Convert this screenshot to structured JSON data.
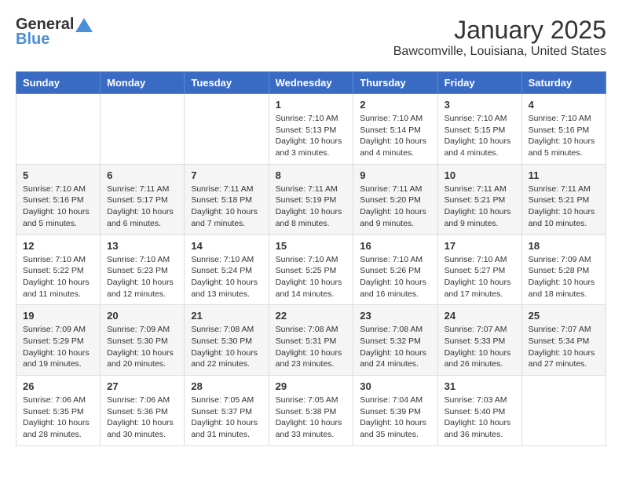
{
  "header": {
    "logo_general": "General",
    "logo_blue": "Blue",
    "month": "January 2025",
    "location": "Bawcomville, Louisiana, United States"
  },
  "weekdays": [
    "Sunday",
    "Monday",
    "Tuesday",
    "Wednesday",
    "Thursday",
    "Friday",
    "Saturday"
  ],
  "weeks": [
    [
      {
        "day": "",
        "info": ""
      },
      {
        "day": "",
        "info": ""
      },
      {
        "day": "",
        "info": ""
      },
      {
        "day": "1",
        "info": "Sunrise: 7:10 AM\nSunset: 5:13 PM\nDaylight: 10 hours\nand 3 minutes."
      },
      {
        "day": "2",
        "info": "Sunrise: 7:10 AM\nSunset: 5:14 PM\nDaylight: 10 hours\nand 4 minutes."
      },
      {
        "day": "3",
        "info": "Sunrise: 7:10 AM\nSunset: 5:15 PM\nDaylight: 10 hours\nand 4 minutes."
      },
      {
        "day": "4",
        "info": "Sunrise: 7:10 AM\nSunset: 5:16 PM\nDaylight: 10 hours\nand 5 minutes."
      }
    ],
    [
      {
        "day": "5",
        "info": "Sunrise: 7:10 AM\nSunset: 5:16 PM\nDaylight: 10 hours\nand 5 minutes."
      },
      {
        "day": "6",
        "info": "Sunrise: 7:11 AM\nSunset: 5:17 PM\nDaylight: 10 hours\nand 6 minutes."
      },
      {
        "day": "7",
        "info": "Sunrise: 7:11 AM\nSunset: 5:18 PM\nDaylight: 10 hours\nand 7 minutes."
      },
      {
        "day": "8",
        "info": "Sunrise: 7:11 AM\nSunset: 5:19 PM\nDaylight: 10 hours\nand 8 minutes."
      },
      {
        "day": "9",
        "info": "Sunrise: 7:11 AM\nSunset: 5:20 PM\nDaylight: 10 hours\nand 9 minutes."
      },
      {
        "day": "10",
        "info": "Sunrise: 7:11 AM\nSunset: 5:21 PM\nDaylight: 10 hours\nand 9 minutes."
      },
      {
        "day": "11",
        "info": "Sunrise: 7:11 AM\nSunset: 5:21 PM\nDaylight: 10 hours\nand 10 minutes."
      }
    ],
    [
      {
        "day": "12",
        "info": "Sunrise: 7:10 AM\nSunset: 5:22 PM\nDaylight: 10 hours\nand 11 minutes."
      },
      {
        "day": "13",
        "info": "Sunrise: 7:10 AM\nSunset: 5:23 PM\nDaylight: 10 hours\nand 12 minutes."
      },
      {
        "day": "14",
        "info": "Sunrise: 7:10 AM\nSunset: 5:24 PM\nDaylight: 10 hours\nand 13 minutes."
      },
      {
        "day": "15",
        "info": "Sunrise: 7:10 AM\nSunset: 5:25 PM\nDaylight: 10 hours\nand 14 minutes."
      },
      {
        "day": "16",
        "info": "Sunrise: 7:10 AM\nSunset: 5:26 PM\nDaylight: 10 hours\nand 16 minutes."
      },
      {
        "day": "17",
        "info": "Sunrise: 7:10 AM\nSunset: 5:27 PM\nDaylight: 10 hours\nand 17 minutes."
      },
      {
        "day": "18",
        "info": "Sunrise: 7:09 AM\nSunset: 5:28 PM\nDaylight: 10 hours\nand 18 minutes."
      }
    ],
    [
      {
        "day": "19",
        "info": "Sunrise: 7:09 AM\nSunset: 5:29 PM\nDaylight: 10 hours\nand 19 minutes."
      },
      {
        "day": "20",
        "info": "Sunrise: 7:09 AM\nSunset: 5:30 PM\nDaylight: 10 hours\nand 20 minutes."
      },
      {
        "day": "21",
        "info": "Sunrise: 7:08 AM\nSunset: 5:30 PM\nDaylight: 10 hours\nand 22 minutes."
      },
      {
        "day": "22",
        "info": "Sunrise: 7:08 AM\nSunset: 5:31 PM\nDaylight: 10 hours\nand 23 minutes."
      },
      {
        "day": "23",
        "info": "Sunrise: 7:08 AM\nSunset: 5:32 PM\nDaylight: 10 hours\nand 24 minutes."
      },
      {
        "day": "24",
        "info": "Sunrise: 7:07 AM\nSunset: 5:33 PM\nDaylight: 10 hours\nand 26 minutes."
      },
      {
        "day": "25",
        "info": "Sunrise: 7:07 AM\nSunset: 5:34 PM\nDaylight: 10 hours\nand 27 minutes."
      }
    ],
    [
      {
        "day": "26",
        "info": "Sunrise: 7:06 AM\nSunset: 5:35 PM\nDaylight: 10 hours\nand 28 minutes."
      },
      {
        "day": "27",
        "info": "Sunrise: 7:06 AM\nSunset: 5:36 PM\nDaylight: 10 hours\nand 30 minutes."
      },
      {
        "day": "28",
        "info": "Sunrise: 7:05 AM\nSunset: 5:37 PM\nDaylight: 10 hours\nand 31 minutes."
      },
      {
        "day": "29",
        "info": "Sunrise: 7:05 AM\nSunset: 5:38 PM\nDaylight: 10 hours\nand 33 minutes."
      },
      {
        "day": "30",
        "info": "Sunrise: 7:04 AM\nSunset: 5:39 PM\nDaylight: 10 hours\nand 35 minutes."
      },
      {
        "day": "31",
        "info": "Sunrise: 7:03 AM\nSunset: 5:40 PM\nDaylight: 10 hours\nand 36 minutes."
      },
      {
        "day": "",
        "info": ""
      }
    ]
  ]
}
